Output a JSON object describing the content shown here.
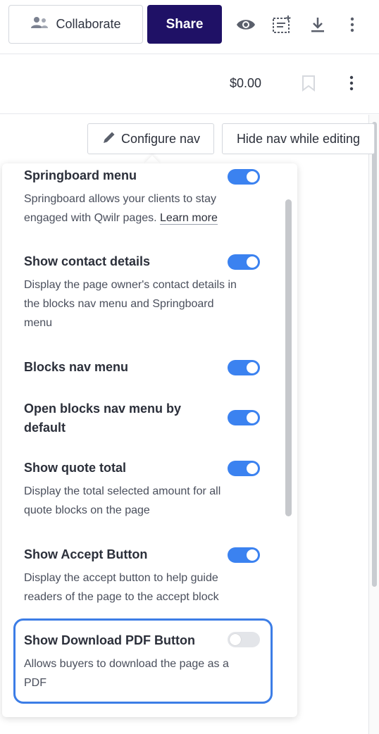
{
  "topbar": {
    "collaborate_label": "Collaborate",
    "share_label": "Share",
    "share_color": "#1f1166",
    "icons": [
      "users-icon",
      "eye-icon",
      "list-add-icon",
      "download-icon",
      "more-vertical-icon"
    ]
  },
  "header2": {
    "price": "$0.00"
  },
  "nav_buttons": {
    "configure_label": "Configure nav",
    "hide_label": "Hide nav while editing"
  },
  "settings": [
    {
      "title": "Springboard menu",
      "desc": "Springboard allows your clients to stay engaged with Qwilr pages.",
      "link": "Learn more",
      "enabled": true
    },
    {
      "title": "Show contact details",
      "desc": "Display the page owner's contact details in the blocks nav menu and Springboard menu",
      "enabled": true
    },
    {
      "title": "Blocks nav menu",
      "desc": "",
      "enabled": true
    },
    {
      "title": "Open blocks nav menu by default",
      "desc": "",
      "enabled": true
    },
    {
      "title": "Show quote total",
      "desc": "Display the total selected amount for all quote blocks on the page",
      "enabled": true
    },
    {
      "title": "Show Accept Button",
      "desc": "Display the accept button to help guide readers of the page to the accept block",
      "enabled": true
    },
    {
      "title": "Show Download PDF Button",
      "desc": "Allows buyers to download the page as a PDF",
      "enabled": false
    }
  ],
  "colors": {
    "toggle_on": "#3b82f0",
    "toggle_off": "#e3e5e9",
    "highlight": "#3c7de6"
  }
}
